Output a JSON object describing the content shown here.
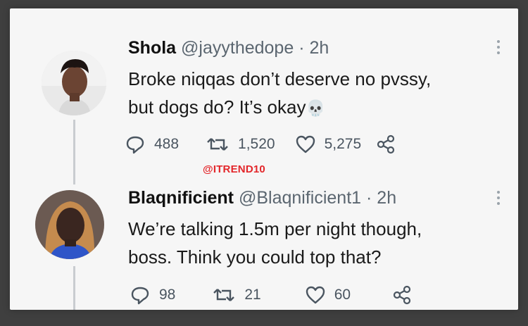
{
  "tweets": [
    {
      "name": "Shola",
      "handle": "@jayythedope",
      "separator": "·",
      "time": "2h",
      "text_lines": [
        "Broke niqqas don’t deserve no pvssy,",
        "but dogs do? It’s okay"
      ],
      "emoji": "💀",
      "replies": "488",
      "retweets": "1,520",
      "likes": "5,275",
      "avatar_icon": "profile-photo"
    },
    {
      "name": "Blaqnificient",
      "handle": "@Blaqnificient1",
      "separator": "·",
      "time": "2h",
      "text_lines": [
        "We’re talking 1.5m per night though,",
        "boss. Think you could top that?"
      ],
      "replies": "98",
      "retweets": "21",
      "likes": "60",
      "avatar_icon": "profile-photo"
    }
  ],
  "watermark": "@ITREND10",
  "colors": {
    "background": "#3f3f3f",
    "card": "#f6f6f6",
    "watermark": "#e3262a",
    "secondary_text": "#5b6670"
  }
}
